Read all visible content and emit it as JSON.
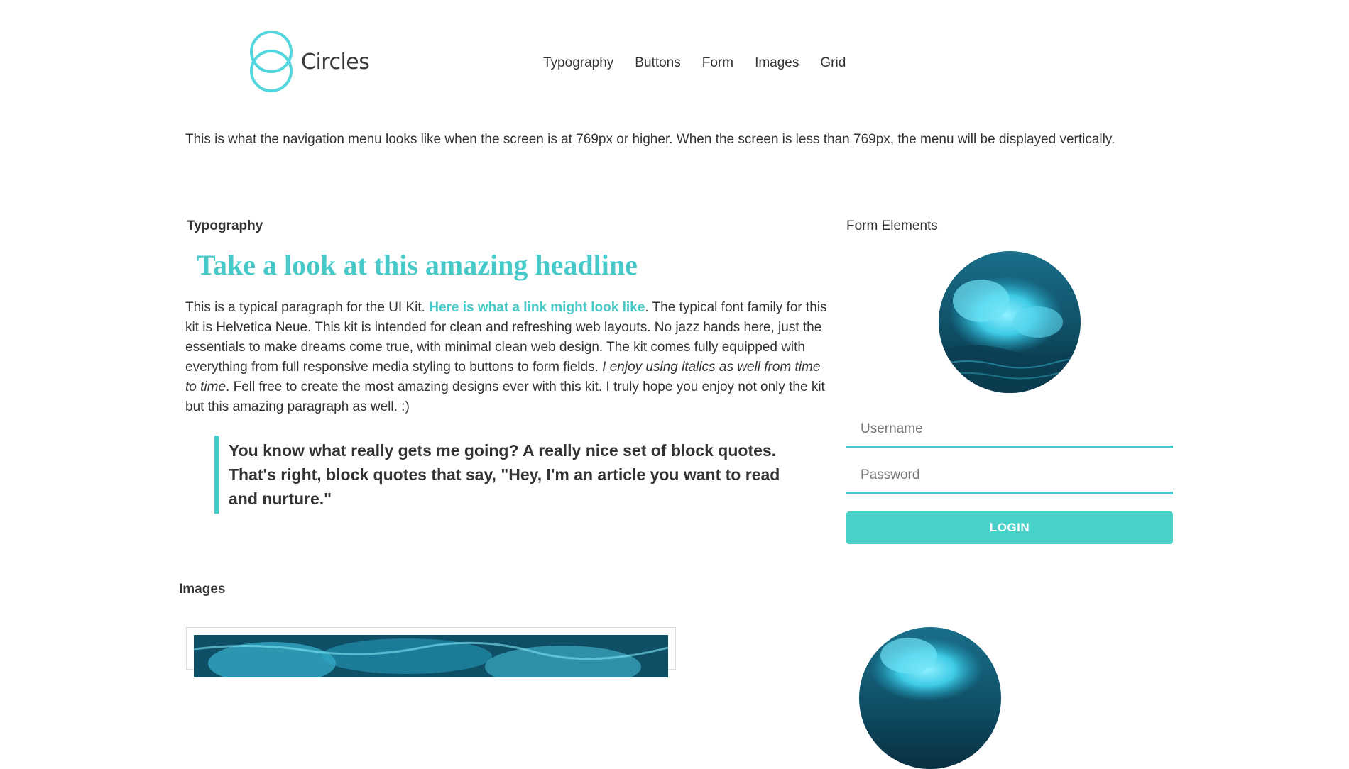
{
  "brand": {
    "name": "Circles",
    "accent": "#48c9c9"
  },
  "nav": {
    "items": [
      "Typography",
      "Buttons",
      "Form",
      "Images",
      "Grid"
    ]
  },
  "intro": "This is what the navigation menu looks like when the screen is at 769px or higher. When the screen is less than 769px, the menu will be displayed vertically.",
  "typography": {
    "section_title": "Typography",
    "headline": "Take a look at this amazing headline",
    "paragraph": {
      "part1": "This is a typical paragraph for the UI Kit. ",
      "link": "Here is what a link might look like",
      "part2": ". The typical font family for this kit is Helvetica Neue. This kit is intended for clean and refreshing web layouts. No jazz hands here, just the essentials to make dreams come true, with minimal clean web design. The kit comes fully equipped with everything from full responsive media styling to buttons to form fields. ",
      "italic": "I enjoy using italics as well from time to time",
      "part3": ". Fell free to create the most amazing designs ever with this kit. I truly hope you enjoy not only the kit but this amazing paragraph as well. :)"
    },
    "blockquote": "You know what really gets me going? A really nice set of block quotes. That's right, block quotes that say, \"Hey, I'm an article you want to read and nurture.\""
  },
  "form": {
    "section_title": "Form Elements",
    "username_placeholder": "Username",
    "password_placeholder": "Password",
    "login_label": "LOGIN",
    "image_icon": "ocean-wave-image"
  },
  "images": {
    "section_title": "Images",
    "image_icon": "ocean-wave-image"
  }
}
